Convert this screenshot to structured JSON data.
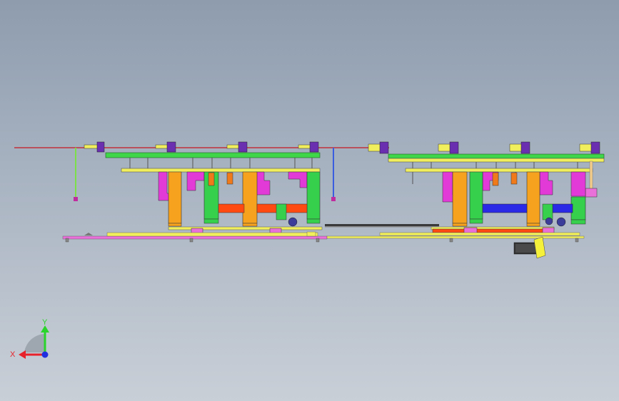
{
  "triad": {
    "x_label": "X",
    "y_label": "Y",
    "x_color": "#e8222a",
    "y_color": "#2bd42b",
    "z_color": "#2231e0"
  },
  "colors": {
    "rail": "#c0303a",
    "top_plate": "#3fd64a",
    "yellow": "#f2ef5c",
    "orange": "#f7a21f",
    "green": "#36d04c",
    "magenta": "#e23ad6",
    "red": "#ff4a12",
    "blue": "#2a2ae6",
    "base": "#e870d8",
    "motor": "#f5f03a"
  }
}
